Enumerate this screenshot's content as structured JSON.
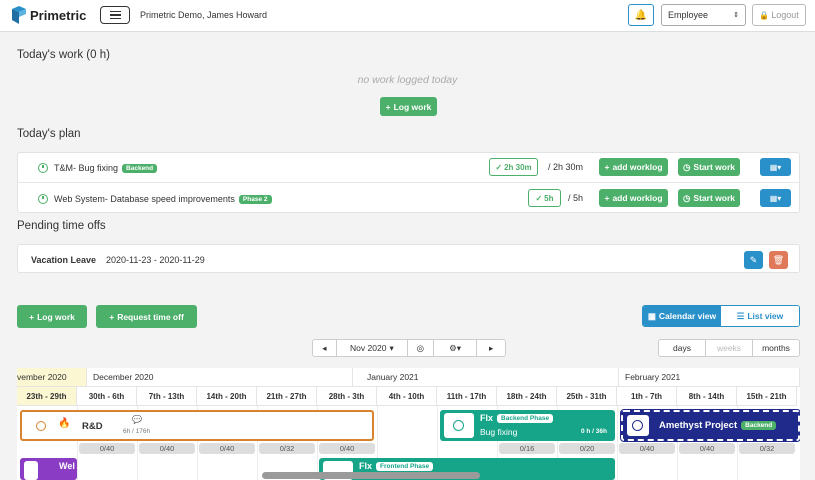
{
  "app": {
    "name": "Primetric",
    "org_user": "Primetric Demo, James Howard"
  },
  "header": {
    "role_selected": "Employee",
    "logout_label": "Logout"
  },
  "colors": {
    "green": "#4caf6a",
    "blue": "#2a90c9",
    "teal": "#17a589",
    "navy": "#1f2a8a",
    "orange": "#d8832f",
    "red": "#e0795a"
  },
  "todays_work": {
    "title": "Today's work (0 h)",
    "empty_text": "no work logged today",
    "log_button": "Log work"
  },
  "todays_plan": {
    "title": "Today's plan",
    "rows": [
      {
        "name": "T&M- Bug fixing",
        "tag": "Backend",
        "logged": "2h 30m",
        "planned": "/ 2h 30m",
        "add_worklog": "add worklog",
        "start_work": "Start work"
      },
      {
        "name": "Web System- Database speed improvements",
        "tag": "Phase 2",
        "logged": "5h",
        "planned": "/ 5h",
        "add_worklog": "add worklog",
        "start_work": "Start work"
      }
    ]
  },
  "pending": {
    "title": "Pending time offs",
    "item": {
      "name": "Vacation Leave",
      "dates": "2020-11-23 - 2020-11-29"
    }
  },
  "actions": {
    "log_work": "Log work",
    "request_time_off": "Request time off"
  },
  "views": {
    "calendar": "Calendar view",
    "list": "List view"
  },
  "nav": {
    "month": "Nov 2020",
    "scales": [
      "days",
      "weeks",
      "months"
    ]
  },
  "timeline": {
    "months": [
      "vember 2020",
      "December 2020",
      "January 2021",
      "February 2021"
    ],
    "weeks": [
      "23th - 29th",
      "30th - 6th",
      "7th - 13th",
      "14th - 20th",
      "21th - 27th",
      "28th - 3th",
      "4th - 10th",
      "11th - 17th",
      "18th - 24th",
      "25th - 31th",
      "1th - 7th",
      "8th - 14th",
      "15th - 21th"
    ],
    "hours": [
      "",
      "0/40",
      "0/40",
      "0/40",
      "0/32",
      "0/40",
      "",
      "",
      "0/16",
      "0/20",
      "0/40",
      "0/40",
      "0/32"
    ],
    "rd_project": {
      "name": "R&D",
      "hours": "6h / 176h"
    },
    "flx_bug": {
      "name": "Flx",
      "tag": "Backend Phase",
      "task": "Bug fixing",
      "hours": "0 h / 36h"
    },
    "amethyst": {
      "name": "Amethyst Project",
      "tag": "Backend"
    },
    "flx_frontend": {
      "name": "Flx",
      "tag": "Frontend Phase"
    },
    "web_partial": "Wel"
  }
}
